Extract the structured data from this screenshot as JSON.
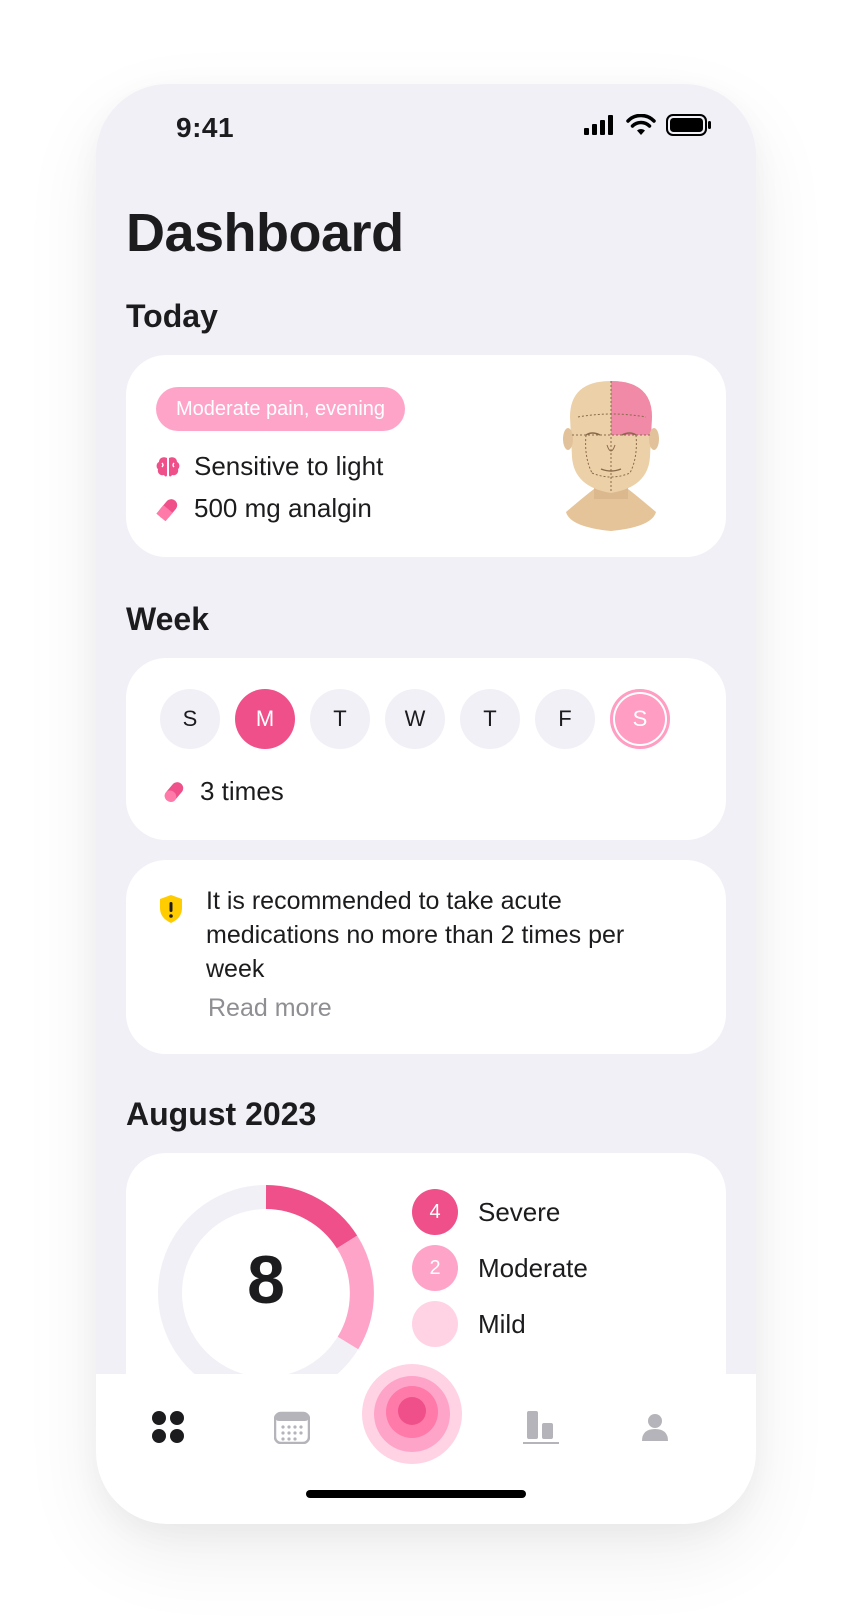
{
  "status_bar": {
    "time": "9:41"
  },
  "page_title": "Dashboard",
  "today": {
    "heading": "Today",
    "badge": "Moderate pain, evening",
    "items": [
      {
        "icon": "brain-icon",
        "text": "Sensitive to light"
      },
      {
        "icon": "pill-icon",
        "text": "500 mg analgin"
      }
    ]
  },
  "week": {
    "heading": "Week",
    "days": [
      "S",
      "M",
      "T",
      "W",
      "T",
      "F",
      "S"
    ],
    "medication_count": "3 times"
  },
  "notice": {
    "icon": "warning-shield-icon",
    "text": "It is recommended to take acute medications no more than 2 times per week",
    "link": "Read more"
  },
  "month": {
    "heading": "August 2023",
    "total": "8",
    "legend": [
      {
        "count": "4",
        "label": "Severe",
        "color": "#f0508a"
      },
      {
        "count": "2",
        "label": "Moderate",
        "color": "#ffa4c9"
      },
      {
        "count": "",
        "label": "Mild",
        "color": "#ffd3e4"
      }
    ]
  },
  "colors": {
    "accent": "#f0508a",
    "accent_light": "#ffa4c9",
    "warning": "#ffcc00",
    "background": "#f1f0f6"
  },
  "tab_bar": [
    "dashboard-icon",
    "calendar-icon",
    "record-pain-icon",
    "statistics-icon",
    "profile-icon"
  ]
}
